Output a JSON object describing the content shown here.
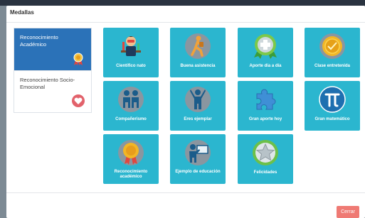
{
  "modal": {
    "title": "Medallas"
  },
  "categories": [
    {
      "label": "Reconocimiento Académico",
      "icon": "medal-ribbon-icon",
      "active": true
    },
    {
      "label": "Reconocimiento Socio-Emocional",
      "icon": "heart-badge-icon",
      "active": false
    }
  ],
  "medals": [
    {
      "label": "Científico nato",
      "icon": "scientist-icon"
    },
    {
      "label": "Buena asistencia",
      "icon": "walking-student-icon"
    },
    {
      "label": "Aporte día a día",
      "icon": "medical-cross-medal-icon"
    },
    {
      "label": "Clase entretenida",
      "icon": "gold-seal-icon"
    },
    {
      "label": "Compañerismo",
      "icon": "friends-icon"
    },
    {
      "label": "Eres ejemplar",
      "icon": "person-arms-up-icon"
    },
    {
      "label": "Gran aporte hoy",
      "icon": "puzzle-piece-icon"
    },
    {
      "label": "Gran matemático",
      "icon": "pi-icon"
    },
    {
      "label": "Reconocimiento académico",
      "icon": "gold-medal-icon"
    },
    {
      "label": "Ejemplo de educación",
      "icon": "teacher-board-icon"
    },
    {
      "label": "Felicidades",
      "icon": "silver-star-icon"
    }
  ],
  "footer": {
    "close_label": "Cerrar"
  },
  "colors": {
    "badge_background": "#2bb6cf",
    "active_category": "#2b72b8",
    "close_button": "#ef7a74"
  }
}
